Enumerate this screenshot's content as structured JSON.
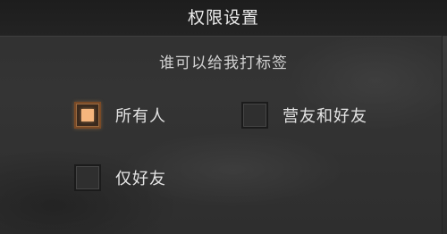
{
  "dialog": {
    "title": "权限设置",
    "prompt": "谁可以给我打标签"
  },
  "options": [
    {
      "label": "所有人",
      "checked": true
    },
    {
      "label": "营友和好友",
      "checked": false
    },
    {
      "label": "仅好友",
      "checked": false
    }
  ],
  "colors": {
    "accent": "#f6b67d",
    "text": "#e4e4e4",
    "background": "#303030"
  }
}
